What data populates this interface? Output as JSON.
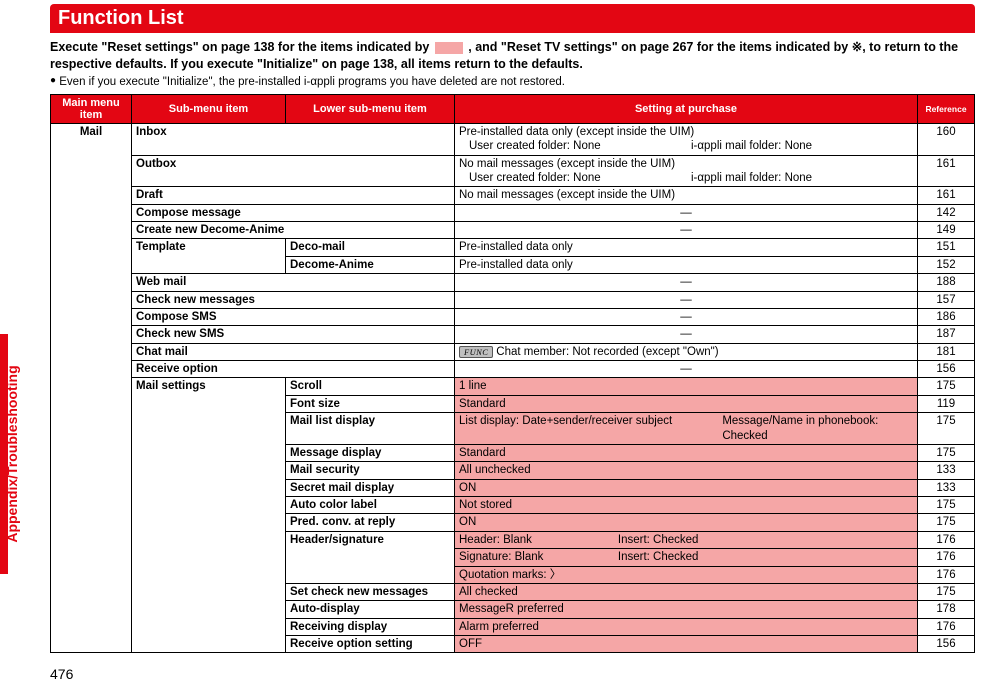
{
  "sideTab": "Appendix/Troubleshooting",
  "pageNumber": "476",
  "title": "Function List",
  "intro1a": "Execute \"Reset settings\" on page 138 for the items indicated by ",
  "intro1b": " , and \"Reset TV settings\" on page 267 for the items indicated by ",
  "introX": "※",
  "intro1c": ", to return to the respective defaults. If you execute \"Initialize\" on page 138, all items return to the defaults.",
  "note": "Even if you execute \"Initialize\", the pre-installed i-αppli programs you have deleted are not restored.",
  "headers": {
    "main": "Main menu item",
    "sub": "Sub-menu item",
    "low": "Lower sub-menu item",
    "set": "Setting at purchase",
    "ref": "Reference"
  },
  "mainItem": "Mail",
  "chart_data": {
    "type": "table",
    "title": "Function List",
    "columns": [
      "Main menu item",
      "Sub-menu item",
      "Lower sub-menu item",
      "Setting at purchase",
      "Reference"
    ],
    "rows": [
      [
        "Mail",
        "Inbox",
        "",
        "Pre-installed data only (except inside the UIM); User created folder: None; i-αppli mail folder: None",
        "160"
      ],
      [
        "",
        "Outbox",
        "",
        "No mail messages (except inside the UIM); User created folder: None; i-αppli mail folder: None",
        "161"
      ],
      [
        "",
        "Draft",
        "",
        "No mail messages (except inside the UIM)",
        "161"
      ],
      [
        "",
        "Compose message",
        "",
        "—",
        "142"
      ],
      [
        "",
        "Create new Decome-Anime",
        "",
        "—",
        "149"
      ],
      [
        "",
        "Template",
        "Deco-mail",
        "Pre-installed data only",
        "151"
      ],
      [
        "",
        "",
        "Decome-Anime",
        "Pre-installed data only",
        "152"
      ],
      [
        "",
        "Web mail",
        "",
        "—",
        "188"
      ],
      [
        "",
        "Check new messages",
        "",
        "—",
        "157"
      ],
      [
        "",
        "Compose SMS",
        "",
        "—",
        "186"
      ],
      [
        "",
        "Check new SMS",
        "",
        "—",
        "187"
      ],
      [
        "",
        "Chat mail",
        "",
        "FUNC Chat member: Not recorded (except \"Own\")",
        "181"
      ],
      [
        "",
        "Receive option",
        "",
        "—",
        "156"
      ],
      [
        "",
        "Mail settings",
        "Scroll",
        "1 line",
        "175"
      ],
      [
        "",
        "",
        "Font size",
        "Standard",
        "119"
      ],
      [
        "",
        "",
        "Mail list display",
        "List display: Date+sender/receiver subject    Message/Name in phonebook: Checked",
        "175"
      ],
      [
        "",
        "",
        "Message display",
        "Standard",
        "175"
      ],
      [
        "",
        "",
        "Mail security",
        "All unchecked",
        "133"
      ],
      [
        "",
        "",
        "Secret mail display",
        "ON",
        "133"
      ],
      [
        "",
        "",
        "Auto color label",
        "Not stored",
        "175"
      ],
      [
        "",
        "",
        "Pred. conv. at reply",
        "ON",
        "175"
      ],
      [
        "",
        "",
        "Header/signature",
        "Header: Blank    Insert: Checked",
        "176"
      ],
      [
        "",
        "",
        "",
        "Signature: Blank    Insert: Checked",
        "176"
      ],
      [
        "",
        "",
        "",
        "Quotation marks: 〉",
        "176"
      ],
      [
        "",
        "",
        "Set check new messages",
        "All checked",
        "175"
      ],
      [
        "",
        "",
        "Auto-display",
        "MessageR preferred",
        "178"
      ],
      [
        "",
        "",
        "Receiving display",
        "Alarm preferred",
        "176"
      ],
      [
        "",
        "",
        "Receive option setting",
        "OFF",
        "156"
      ]
    ]
  },
  "rows": {
    "inbox": {
      "sub": "Inbox",
      "set1": "Pre-installed data only (except inside the UIM)",
      "set2a": "User created folder: None",
      "set2b": "i-αppli mail folder: None",
      "ref": "160"
    },
    "outbox": {
      "sub": "Outbox",
      "set1": "No mail messages (except inside the UIM)",
      "set2a": "User created folder: None",
      "set2b": "i-αppli mail folder: None",
      "ref": "161"
    },
    "draft": {
      "sub": "Draft",
      "set": "No mail messages (except inside the UIM)",
      "ref": "161"
    },
    "compose": {
      "sub": "Compose message",
      "set": "—",
      "ref": "142"
    },
    "createAnime": {
      "sub": "Create new Decome-Anime",
      "set": "—",
      "ref": "149"
    },
    "template": {
      "sub": "Template"
    },
    "decomail": {
      "low": "Deco-mail",
      "set": "Pre-installed data only",
      "ref": "151"
    },
    "decomeAnime": {
      "low": "Decome-Anime",
      "set": "Pre-installed data only",
      "ref": "152"
    },
    "webmail": {
      "sub": "Web mail",
      "set": "—",
      "ref": "188"
    },
    "checknew": {
      "sub": "Check new messages",
      "set": "—",
      "ref": "157"
    },
    "compsms": {
      "sub": "Compose SMS",
      "set": "—",
      "ref": "186"
    },
    "checksms": {
      "sub": "Check new SMS",
      "set": "—",
      "ref": "187"
    },
    "chatmail": {
      "sub": "Chat mail",
      "func": "FUNC",
      "set": "Chat member: Not recorded (except \"Own\")",
      "ref": "181"
    },
    "recvopt": {
      "sub": "Receive option",
      "set": "—",
      "ref": "156"
    },
    "mailset": {
      "sub": "Mail settings"
    },
    "scroll": {
      "low": "Scroll",
      "set": "1 line",
      "ref": "175"
    },
    "fontsize": {
      "low": "Font size",
      "set": "Standard",
      "ref": "119"
    },
    "maillist": {
      "low": "Mail list display",
      "setA": "List display: Date+sender/receiver subject",
      "setB": "Message/Name in phonebook: Checked",
      "ref": "175"
    },
    "msgdisp": {
      "low": "Message display",
      "set": "Standard",
      "ref": "175"
    },
    "mailsec": {
      "low": "Mail security",
      "set": "All unchecked",
      "ref": "133"
    },
    "secret": {
      "low": "Secret mail display",
      "set": "ON",
      "ref": "133"
    },
    "autocolor": {
      "low": "Auto color label",
      "set": "Not stored",
      "ref": "175"
    },
    "pred": {
      "low": "Pred. conv. at reply",
      "set": "ON",
      "ref": "175"
    },
    "headersig": {
      "low": "Header/signature"
    },
    "hs1": {
      "setA": "Header: Blank",
      "setB": "Insert: Checked",
      "ref": "176"
    },
    "hs2": {
      "setA": "Signature: Blank",
      "setB": "Insert: Checked",
      "ref": "176"
    },
    "hs3": {
      "set": "Quotation marks: 〉",
      "ref": "176"
    },
    "setcheck": {
      "low": "Set check new messages",
      "set": "All checked",
      "ref": "175"
    },
    "autodisp": {
      "low": "Auto-display",
      "set": "MessageR preferred",
      "ref": "178"
    },
    "recvdisp": {
      "low": "Receiving display",
      "set": "Alarm preferred",
      "ref": "176"
    },
    "recvoptset": {
      "low": "Receive option setting",
      "set": "OFF",
      "ref": "156"
    }
  }
}
